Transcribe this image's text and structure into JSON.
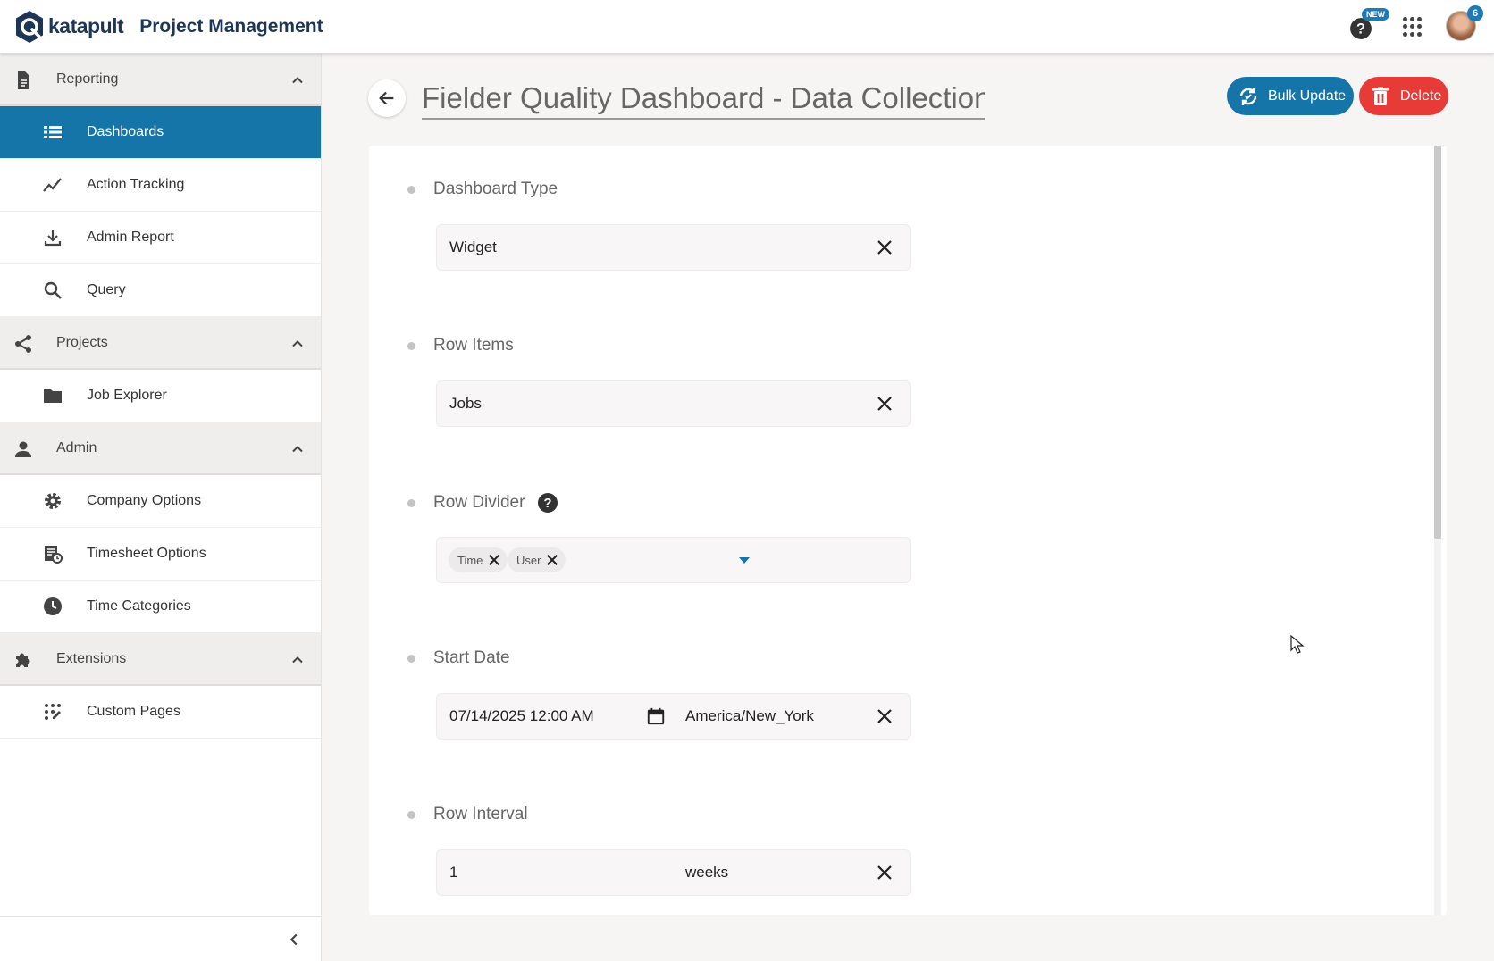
{
  "header": {
    "logo_text": "katapult",
    "app_title": "Project Management",
    "new_badge": "NEW",
    "notification_count": "6"
  },
  "sidebar": {
    "sections": [
      {
        "label": "Reporting",
        "icon": "document-icon",
        "items": [
          {
            "label": "Dashboards",
            "icon": "list-icon",
            "active": true
          },
          {
            "label": "Action Tracking",
            "icon": "trend-icon"
          },
          {
            "label": "Admin Report",
            "icon": "download-icon"
          },
          {
            "label": "Query",
            "icon": "search-icon"
          }
        ]
      },
      {
        "label": "Projects",
        "icon": "share-icon",
        "items": [
          {
            "label": "Job Explorer",
            "icon": "folder-icon"
          }
        ]
      },
      {
        "label": "Admin",
        "icon": "person-icon",
        "items": [
          {
            "label": "Company Options",
            "icon": "gear-icon"
          },
          {
            "label": "Timesheet Options",
            "icon": "timesheet-icon"
          },
          {
            "label": "Time Categories",
            "icon": "clock-icon"
          }
        ]
      },
      {
        "label": "Extensions",
        "icon": "puzzle-icon",
        "items": [
          {
            "label": "Custom Pages",
            "icon": "custom-pages-icon"
          }
        ]
      }
    ]
  },
  "main": {
    "title": "Fielder Quality Dashboard - Data Collection",
    "bulk_update_label": "Bulk Update",
    "delete_label": "Delete",
    "fields": {
      "dashboard_type": {
        "label": "Dashboard Type",
        "value": "Widget"
      },
      "row_items": {
        "label": "Row Items",
        "value": "Jobs"
      },
      "row_divider": {
        "label": "Row Divider",
        "chips": [
          "Time",
          "User"
        ]
      },
      "start_date": {
        "label": "Start Date",
        "value": "07/14/2025 12:00 AM",
        "timezone": "America/New_York"
      },
      "row_interval": {
        "label": "Row Interval",
        "value": "1",
        "unit": "weeks"
      }
    }
  },
  "colors": {
    "primary": "#1574a8",
    "danger": "#e63b36",
    "brand_dark": "#1d3557"
  }
}
